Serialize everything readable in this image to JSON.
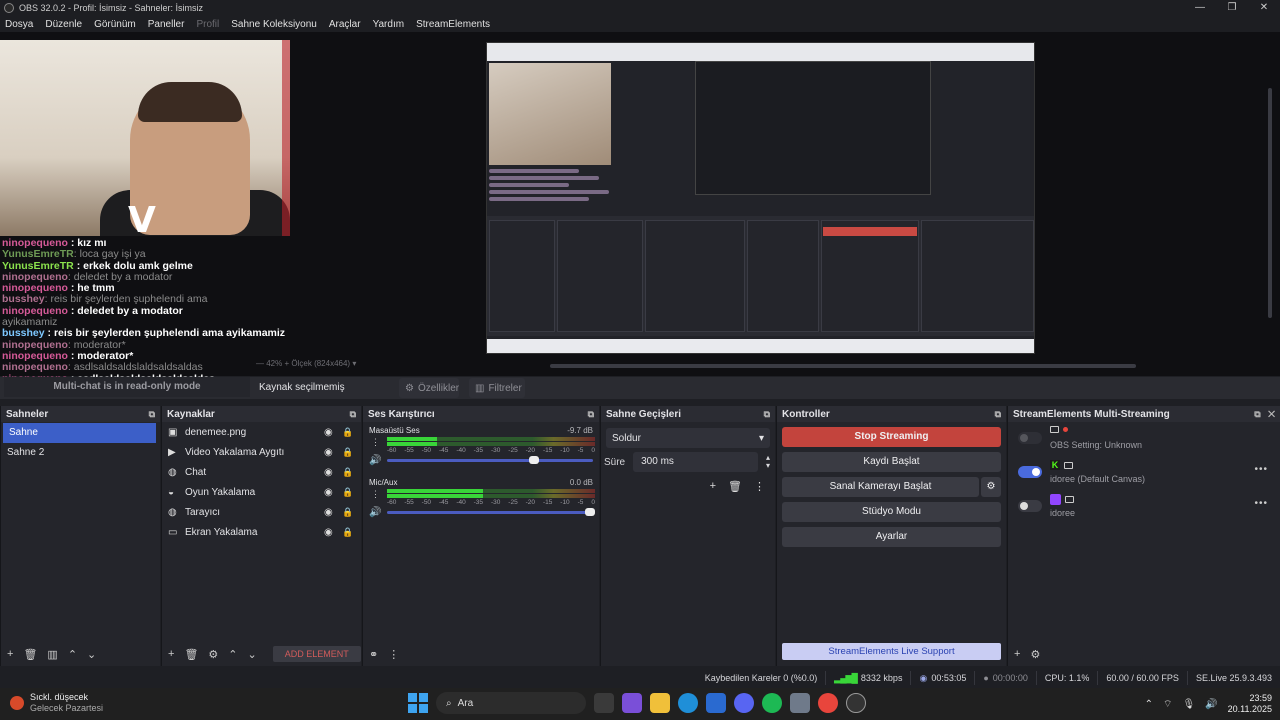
{
  "window": {
    "title": "OBS 32.0.2 - Profil: İsimsiz - Sahneler: İsimsiz",
    "controls": [
      "—",
      "❐",
      "✕"
    ]
  },
  "menu": {
    "items": [
      "Dosya",
      "Düzenle",
      "Görünüm",
      "Paneller",
      "Profil",
      "Sahne Koleksiyonu",
      "Araçlar",
      "Yardım",
      "StreamElements"
    ],
    "disabled_index": 4
  },
  "preview": {
    "chat_lines": [
      {
        "user": "ninopequeno",
        "sep": " : ",
        "msg": "kız mı",
        "user_color": "pink",
        "msg_color": "white"
      },
      {
        "user": "YunusEmreTR",
        "sep": ": ",
        "msg": "loca gay işi ya",
        "user_color": "dimgreen",
        "msg_color": "dim"
      },
      {
        "user": "YunusEmreTR",
        "sep": " : ",
        "msg": "erkek dolu amk gelme",
        "user_color": "green",
        "msg_color": "white"
      },
      {
        "user": "ninopequeno",
        "sep": ": ",
        "msg": "deledet by a modator",
        "user_color": "dimpink",
        "msg_color": "dim"
      },
      {
        "user": "ninopequeno",
        "sep": " : ",
        "msg": "he tmm",
        "user_color": "pink",
        "msg_color": "white"
      },
      {
        "user": "busshey",
        "sep": ": ",
        "msg": "reis bir şeylerden şuphelendi ama",
        "user_color": "dimpink",
        "msg_color": "dim"
      },
      {
        "user": "ninopequeno",
        "sep": " : ",
        "msg": "deledet by a modator",
        "user_color": "pink",
        "msg_color": "white"
      },
      {
        "user": "",
        "sep": "",
        "msg": "ayikamamiz",
        "user_color": "dim",
        "msg_color": "dim"
      },
      {
        "user": "busshey",
        "sep": " : ",
        "msg": "reis bir şeylerden şuphelendi ama ayikamamiz",
        "user_color": "blue",
        "msg_color": "white"
      },
      {
        "user": "ninopequeno",
        "sep": ": ",
        "msg": "moderator*",
        "user_color": "dimpink",
        "msg_color": "dim"
      },
      {
        "user": "ninopequeno",
        "sep": " : ",
        "msg": "moderator*",
        "user_color": "pink",
        "msg_color": "white"
      },
      {
        "user": "ninopequeno",
        "sep": ": ",
        "msg": "asdlsaldsaldslaldsaldsaldas",
        "user_color": "dimpink",
        "msg_color": "dim"
      },
      {
        "user": "ninopequeno",
        "sep": " : ",
        "msg": "asdlsaldsaldsaldsaldsaldas",
        "user_color": "pink",
        "msg_color": "white"
      }
    ],
    "read_only_text": "Multi-chat is in read-only mode",
    "zoom_text": "42%",
    "scale_text": "Ölçek (824x464)",
    "cam_logo": "V"
  },
  "source_bar": {
    "no_source": "Kaynak seçilmemiş",
    "properties": "Özellikler",
    "filters": "Filtreler"
  },
  "scenes": {
    "title": "Sahneler",
    "items": [
      "Sahne",
      "Sahne 2"
    ],
    "active_index": 0
  },
  "sources": {
    "title": "Kaynaklar",
    "items": [
      {
        "name": "denemee.png",
        "icon": "image-icon"
      },
      {
        "name": "Video Yakalama Aygıtı",
        "icon": "camera-icon"
      },
      {
        "name": "Chat",
        "icon": "globe-icon"
      },
      {
        "name": "Oyun Yakalama",
        "icon": "gamepad-icon"
      },
      {
        "name": "Tarayıcı",
        "icon": "globe-icon"
      },
      {
        "name": "Ekran Yakalama",
        "icon": "monitor-icon"
      }
    ],
    "add_element": "ADD ELEMENT"
  },
  "mixer": {
    "title": "Ses Karıştırıcı",
    "channels": [
      {
        "name": "Masaüstü Ses",
        "db": "-9.7 dB",
        "level": 0.24,
        "volume": 0.72
      },
      {
        "name": "Mic/Aux",
        "db": "0.0 dB",
        "level": 0.46,
        "volume": 1.0
      }
    ],
    "ticks": [
      "-60",
      "-55",
      "-50",
      "-45",
      "-40",
      "-35",
      "-30",
      "-25",
      "-20",
      "-15",
      "-10",
      "-5",
      "0"
    ]
  },
  "transitions": {
    "title": "Sahne Geçişleri",
    "selected": "Soldur",
    "duration_label": "Süre",
    "duration_value": "300 ms"
  },
  "controls": {
    "title": "Kontroller",
    "stop_streaming": "Stop Streaming",
    "start_recording": "Kaydı Başlat",
    "start_virtual_cam": "Sanal Kamerayı Başlat",
    "studio_mode": "Stüdyo Modu",
    "settings": "Ayarlar",
    "live_support": "StreamElements Live Support"
  },
  "multistream": {
    "title": "StreamElements Multi-Streaming",
    "rows": [
      {
        "name": "OBS Setting: Unknown",
        "enabled": null,
        "platform": "obs"
      },
      {
        "name": "idoree (Default Canvas)",
        "enabled": true,
        "platform": "kick"
      },
      {
        "name": "idoree",
        "enabled": false,
        "platform": "twitch"
      }
    ]
  },
  "status": {
    "dropped_frames": "Kaybedilen Kareler 0 (%0.0)",
    "bitrate": "8332 kbps",
    "stream_time": "00:53:05",
    "record_time": "00:00:00",
    "cpu": "CPU: 1.1%",
    "fps": "60.00 / 60.00 FPS",
    "version": "SE.Live 25.9.3.493"
  },
  "taskbar": {
    "weather_title": "Sıckl. düşecek",
    "weather_sub": "Gelecek Pazartesi",
    "search_text": "Ara",
    "time": "23:59",
    "date": "20.11.2025"
  },
  "colors": {
    "accent": "#3c5fc8",
    "stop": "#c3443d",
    "meter_green": "#39d539"
  }
}
